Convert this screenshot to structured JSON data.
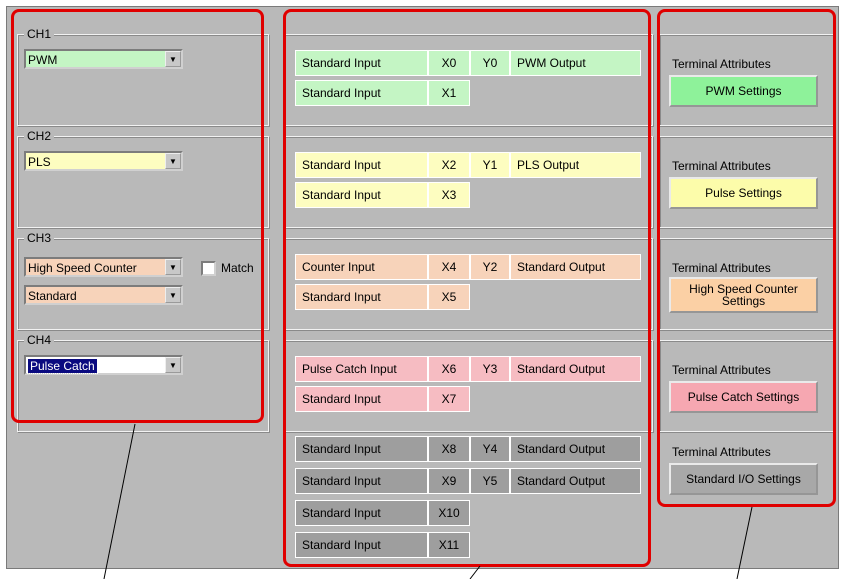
{
  "channels": [
    {
      "label": "CH1",
      "mode": "PWM"
    },
    {
      "label": "CH2",
      "mode": "PLS"
    },
    {
      "label": "CH3",
      "mode": "High Speed Counter",
      "sub_mode": "Standard",
      "match_label": "Match",
      "match_checked": false
    },
    {
      "label": "CH4",
      "mode": "Pulse Catch"
    }
  ],
  "io_rows": [
    {
      "input": "Standard Input",
      "x": "X0",
      "y": "Y0",
      "output": "PWM Output"
    },
    {
      "input": "Standard Input",
      "x": "X1"
    },
    {
      "input": "Standard Input",
      "x": "X2",
      "y": "Y1",
      "output": "PLS Output"
    },
    {
      "input": "Standard Input",
      "x": "X3"
    },
    {
      "input": "Counter Input",
      "x": "X4",
      "y": "Y2",
      "output": "Standard Output"
    },
    {
      "input": "Standard Input",
      "x": "X5"
    },
    {
      "input": "Pulse Catch Input",
      "x": "X6",
      "y": "Y3",
      "output": "Standard Output"
    },
    {
      "input": "Standard Input",
      "x": "X7"
    },
    {
      "input": "Standard Input",
      "x": "X8",
      "y": "Y4",
      "output": "Standard Output"
    },
    {
      "input": "Standard Input",
      "x": "X9",
      "y": "Y5",
      "output": "Standard Output"
    },
    {
      "input": "Standard Input",
      "x": "X10"
    },
    {
      "input": "Standard Input",
      "x": "X11"
    }
  ],
  "attributes": {
    "label": "Terminal Attributes",
    "buttons": [
      "PWM Settings",
      "Pulse Settings",
      "High Speed Counter Settings",
      "Pulse Catch Settings",
      "Standard I/O Settings"
    ]
  },
  "colors": {
    "ch1": "#c4f5c4",
    "ch2": "#fdfdc0",
    "ch3": "#f7d3ba",
    "ch4": "#f6bcc2",
    "standard": "#9e9e9e",
    "highlight": "#e00000"
  }
}
